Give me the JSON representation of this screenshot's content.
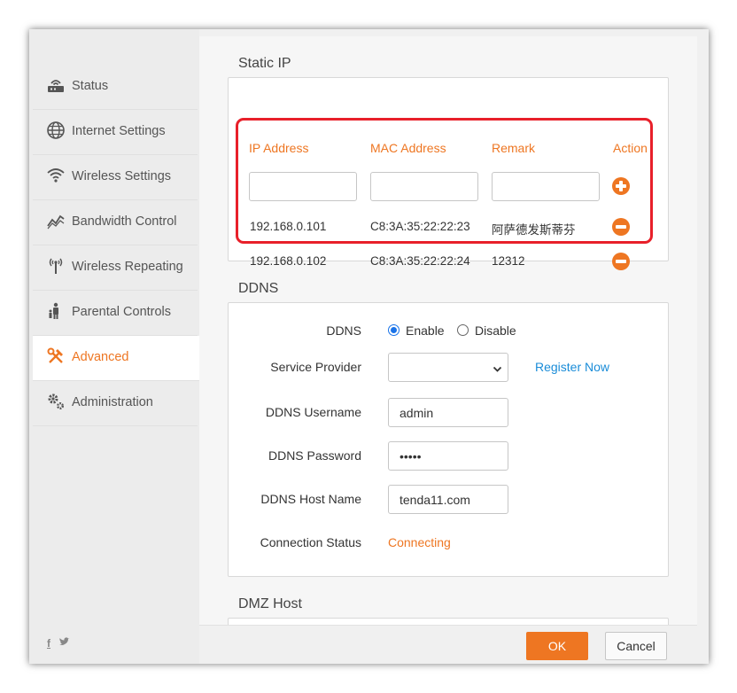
{
  "sidebar": {
    "items": [
      {
        "label": "Status",
        "icon": "router-icon"
      },
      {
        "label": "Internet Settings",
        "icon": "globe-icon"
      },
      {
        "label": "Wireless Settings",
        "icon": "wifi-icon"
      },
      {
        "label": "Bandwidth Control",
        "icon": "chart-line-icon"
      },
      {
        "label": "Wireless Repeating",
        "icon": "antenna-icon"
      },
      {
        "label": "Parental Controls",
        "icon": "family-icon"
      },
      {
        "label": "Advanced",
        "icon": "tools-icon"
      },
      {
        "label": "Administration",
        "icon": "gears-icon"
      }
    ],
    "active": "Advanced",
    "social": {
      "facebook": "f",
      "twitter": "t"
    }
  },
  "static_ip": {
    "title": "Static IP",
    "columns": [
      "IP Address",
      "MAC Address",
      "Remark",
      "Action"
    ],
    "inputs": {
      "ip": "",
      "mac": "",
      "remark": ""
    },
    "rows": [
      {
        "ip": "192.168.0.101",
        "mac": "C8:3A:35:22:22:23",
        "remark": "阿萨德发斯蒂芬"
      },
      {
        "ip": "192.168.0.102",
        "mac": "C8:3A:35:22:22:24",
        "remark": "12312"
      }
    ]
  },
  "ddns": {
    "title": "DDNS",
    "ddns_label": "DDNS",
    "enable_label": "Enable",
    "disable_label": "Disable",
    "enabled": true,
    "provider_label": "Service Provider",
    "provider_value": "",
    "register_link": "Register Now",
    "username_label": "DDNS Username",
    "username_value": "admin",
    "password_label": "DDNS Password",
    "password_value": "•••••",
    "host_label": "DDNS Host Name",
    "host_value": "tenda11.com",
    "status_label": "Connection Status",
    "status_value": "Connecting"
  },
  "dmz": {
    "title": "DMZ Host"
  },
  "footer": {
    "ok_label": "OK",
    "cancel_label": "Cancel"
  },
  "colors": {
    "accent": "#ee7622",
    "link": "#1a8cd8",
    "highlight": "#e8202a",
    "radio": "#1a73e8"
  }
}
